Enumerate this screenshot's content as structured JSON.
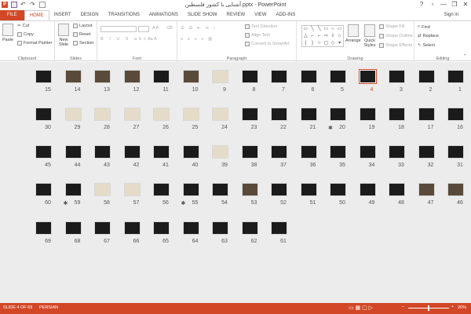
{
  "window": {
    "title": "آشنایی با کشور فلسطین.pptx - PowerPoint",
    "help_symbol": "?",
    "minimize_symbol": "—",
    "restore_symbol": "❐",
    "close_symbol": "✕"
  },
  "tabs": [
    "FILE",
    "HOME",
    "INSERT",
    "DESIGN",
    "TRANSITIONS",
    "ANIMATIONS",
    "SLIDE SHOW",
    "REVIEW",
    "VIEW",
    "ADD-INS"
  ],
  "active_tab": "HOME",
  "sign_in": "Sign in",
  "ribbon": {
    "clipboard": {
      "paste": "Paste",
      "cut": "Cut",
      "copy": "Copy",
      "format_painter": "Format Painter",
      "label": "Clipboard"
    },
    "slides": {
      "new_slide": "New Slide",
      "layout": "Layout",
      "reset": "Reset",
      "section": "Section",
      "label": "Slides"
    },
    "font": {
      "label": "Font"
    },
    "paragraph": {
      "text_direction": "Text Direction",
      "align_text": "Align Text",
      "convert_smartart": "Convert to SmartArt",
      "label": "Paragraph"
    },
    "drawing": {
      "arrange": "Arrange",
      "quick_styles": "Quick Styles",
      "shape_fill": "Shape Fill",
      "shape_outline": "Shape Outline",
      "shape_effects": "Shape Effects",
      "label": "Drawing"
    },
    "editing": {
      "find": "Find",
      "replace": "Replace",
      "select": "Select",
      "label": "Editing"
    }
  },
  "slides": {
    "selected": "4",
    "rows": [
      [
        "15",
        "14",
        "13",
        "12",
        "11",
        "10",
        "9",
        "8",
        "7",
        "6",
        "5",
        "4",
        "3",
        "2",
        "1"
      ],
      [
        "30",
        "29",
        "28",
        "27",
        "26",
        "25",
        "24",
        "23",
        "22",
        "21",
        "20",
        "19",
        "18",
        "17",
        "16"
      ],
      [
        "45",
        "44",
        "43",
        "42",
        "41",
        "40",
        "39",
        "38",
        "37",
        "36",
        "35",
        "34",
        "33",
        "32",
        "31"
      ],
      [
        "60",
        "59",
        "58",
        "57",
        "56",
        "55",
        "54",
        "53",
        "52",
        "51",
        "50",
        "49",
        "48",
        "47",
        "46"
      ],
      [
        "69",
        "68",
        "67",
        "66",
        "65",
        "64",
        "63",
        "62",
        "61"
      ]
    ],
    "star_marks": [
      "20",
      "59",
      "55"
    ]
  },
  "status": {
    "slide_info": "SLIDE 4 OF 69",
    "language": "PERSIAN",
    "zoom": "20%",
    "zoom_fraction": 0.2
  }
}
